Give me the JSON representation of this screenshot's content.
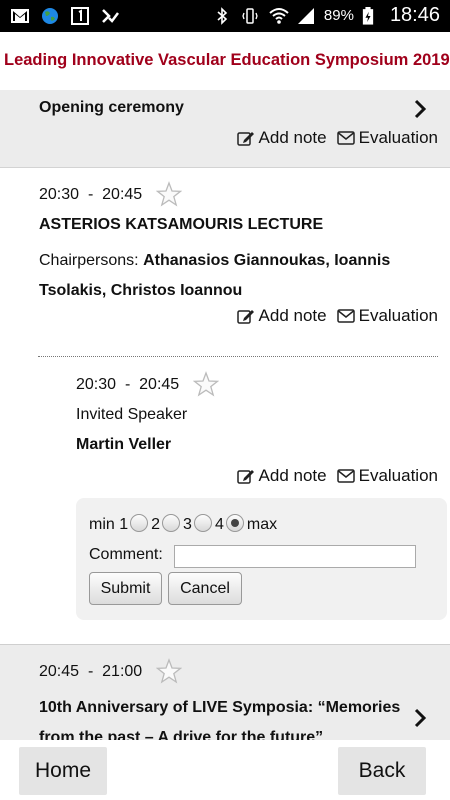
{
  "status_bar": {
    "icons_left": [
      "gmail-icon",
      "globe-icon",
      "calendar-one-icon",
      "download-check-icon"
    ],
    "battery": "89%",
    "time": "18:46"
  },
  "app": {
    "title": "Leading Innovative Vascular Education Symposium 2019"
  },
  "opening": {
    "title": "Opening ceremony",
    "add_note": "Add note",
    "evaluation": "Evaluation"
  },
  "lecture": {
    "start": "20:30",
    "sep": "-",
    "end": "20:45",
    "title": "ASTERIOS KATSAMOURIS LECTURE",
    "chair_label": "Chairpersons:",
    "chair_names_line1": "Athanasios Giannoukas, Ioannis",
    "chair_names_line2": "Tsolakis, Christos Ioannou",
    "add_note": "Add note",
    "evaluation": "Evaluation"
  },
  "talk": {
    "start": "20:30",
    "sep": "-",
    "end": "20:45",
    "role": "Invited Speaker",
    "speaker": "Martin Veller",
    "add_note": "Add note",
    "evaluation": "Evaluation"
  },
  "rating": {
    "min_label": "min",
    "options": [
      "1",
      "2",
      "3",
      "4"
    ],
    "max_label": "max",
    "selected": "max",
    "comment_label": "Comment:",
    "comment_value": "",
    "submit": "Submit",
    "cancel": "Cancel"
  },
  "anniversary": {
    "start": "20:45",
    "sep": "-",
    "end": "21:00",
    "title_line1": "10th Anniversary of LIVE Symposia: “Memories",
    "title_line2": "from the past – A drive for the future”"
  },
  "nav": {
    "home": "Home",
    "back": "Back"
  }
}
